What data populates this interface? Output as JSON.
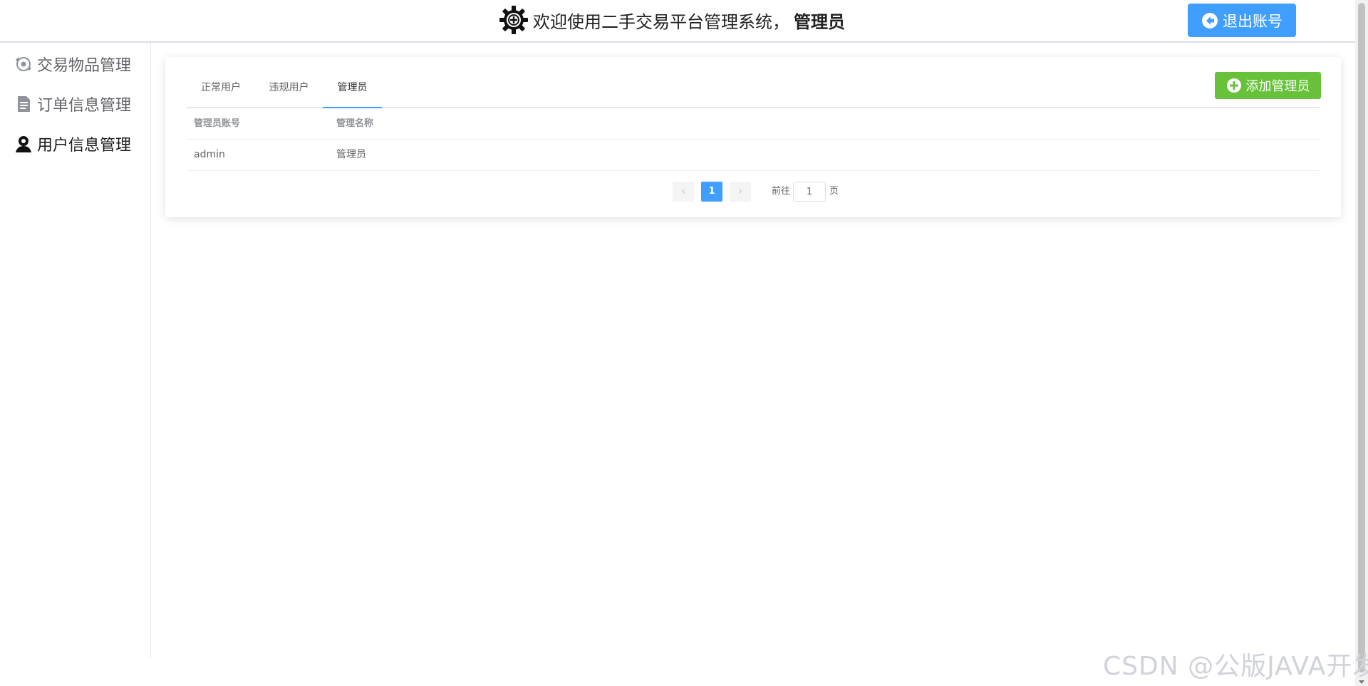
{
  "header": {
    "welcome_text": "欢迎使用二手交易平台管理系统，",
    "role_text": "管理员",
    "logout_label": "退出账号"
  },
  "sidebar": {
    "items": [
      {
        "label": "交易物品管理",
        "icon": "exchange-icon"
      },
      {
        "label": "订单信息管理",
        "icon": "document-icon"
      },
      {
        "label": "用户信息管理",
        "icon": "user-icon",
        "active": true
      }
    ]
  },
  "main": {
    "tabs": [
      {
        "label": "正常用户"
      },
      {
        "label": "违规用户"
      },
      {
        "label": "管理员",
        "active": true
      }
    ],
    "add_button_label": "添加管理员",
    "table": {
      "columns": [
        "管理员账号",
        "管理名称"
      ],
      "rows": [
        [
          "admin",
          "管理员"
        ]
      ]
    },
    "pagination": {
      "prev_symbol": "‹",
      "current_page": "1",
      "next_symbol": "›",
      "goto_prefix": "前往",
      "goto_value": "1",
      "goto_suffix": "页"
    }
  },
  "watermark": "CSDN @公版JAVA开发",
  "colors": {
    "primary": "#409eff",
    "success": "#67c23a",
    "border": "#dcdfe6"
  }
}
